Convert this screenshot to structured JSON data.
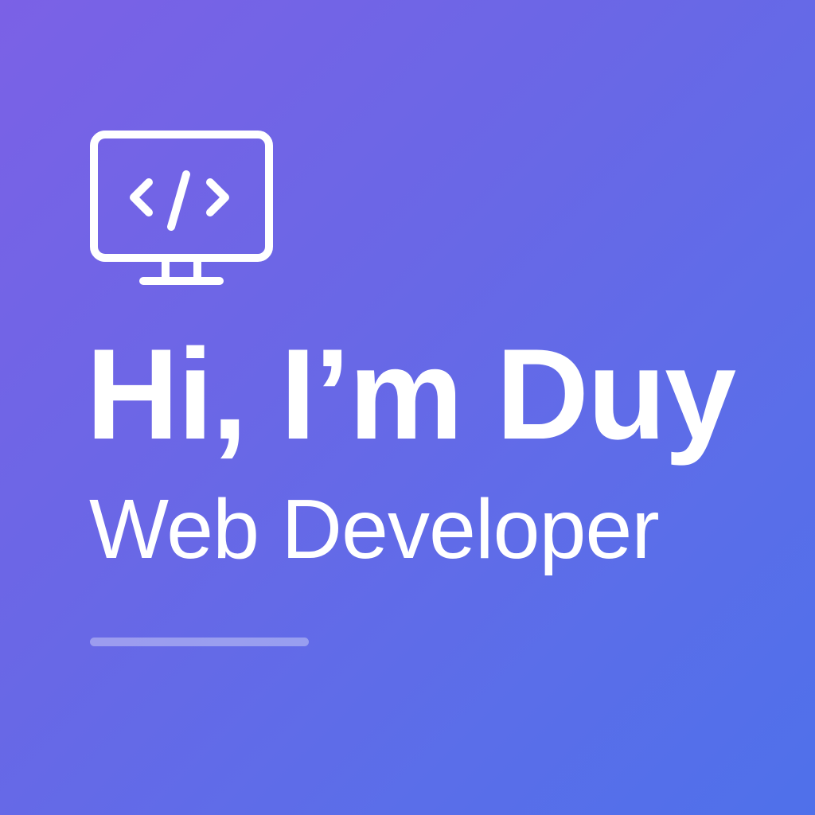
{
  "hero": {
    "icon": "code-monitor-icon",
    "greeting": "Hi, I’m Duy",
    "role": "Web Developer"
  },
  "colors": {
    "gradient_start": "#7b61e6",
    "gradient_end": "#4f70ea",
    "text": "#ffffff"
  }
}
